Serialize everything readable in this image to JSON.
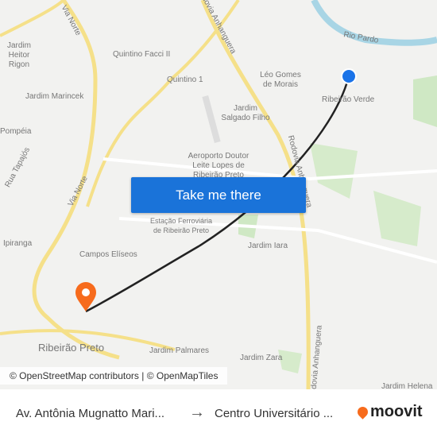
{
  "map": {
    "labels": [
      "Via Norte",
      "Rodovia Anhanguera",
      "Rio Pardo",
      "Jardim Heitor Rigon",
      "Quintino Facci II",
      "Léo Gomes de Morais",
      "Quintino 1",
      "Ribeirão Verde",
      "Jardim Marincek",
      "Jardim Salgado Filho",
      "Pompéia",
      "Rua Tapajós",
      "Aeroporto Doutor Leite Lopes de Ribeirão Preto",
      "Via Norte",
      "Rodovia Anhanguera",
      "Estação Ferroviária de Ribeirão Preto",
      "Jardim Iara",
      "Ipiranga",
      "Campos Elíseos",
      "Ribeirão Preto",
      "Jardim Palmares",
      "Jardim Zara",
      "Jardim Helena",
      "Rodovia Anhanguera"
    ],
    "cta": "Take me there",
    "attribution": "© OpenStreetMap contributors | © OpenMapTiles",
    "route_color": "#222222",
    "origin_color": "#1a73e8",
    "destination_color": "#f76b1c"
  },
  "footer": {
    "from": "Av. Antônia Mugnatto Mari...",
    "to": "Centro Universitário ...",
    "brand": "moovit"
  }
}
